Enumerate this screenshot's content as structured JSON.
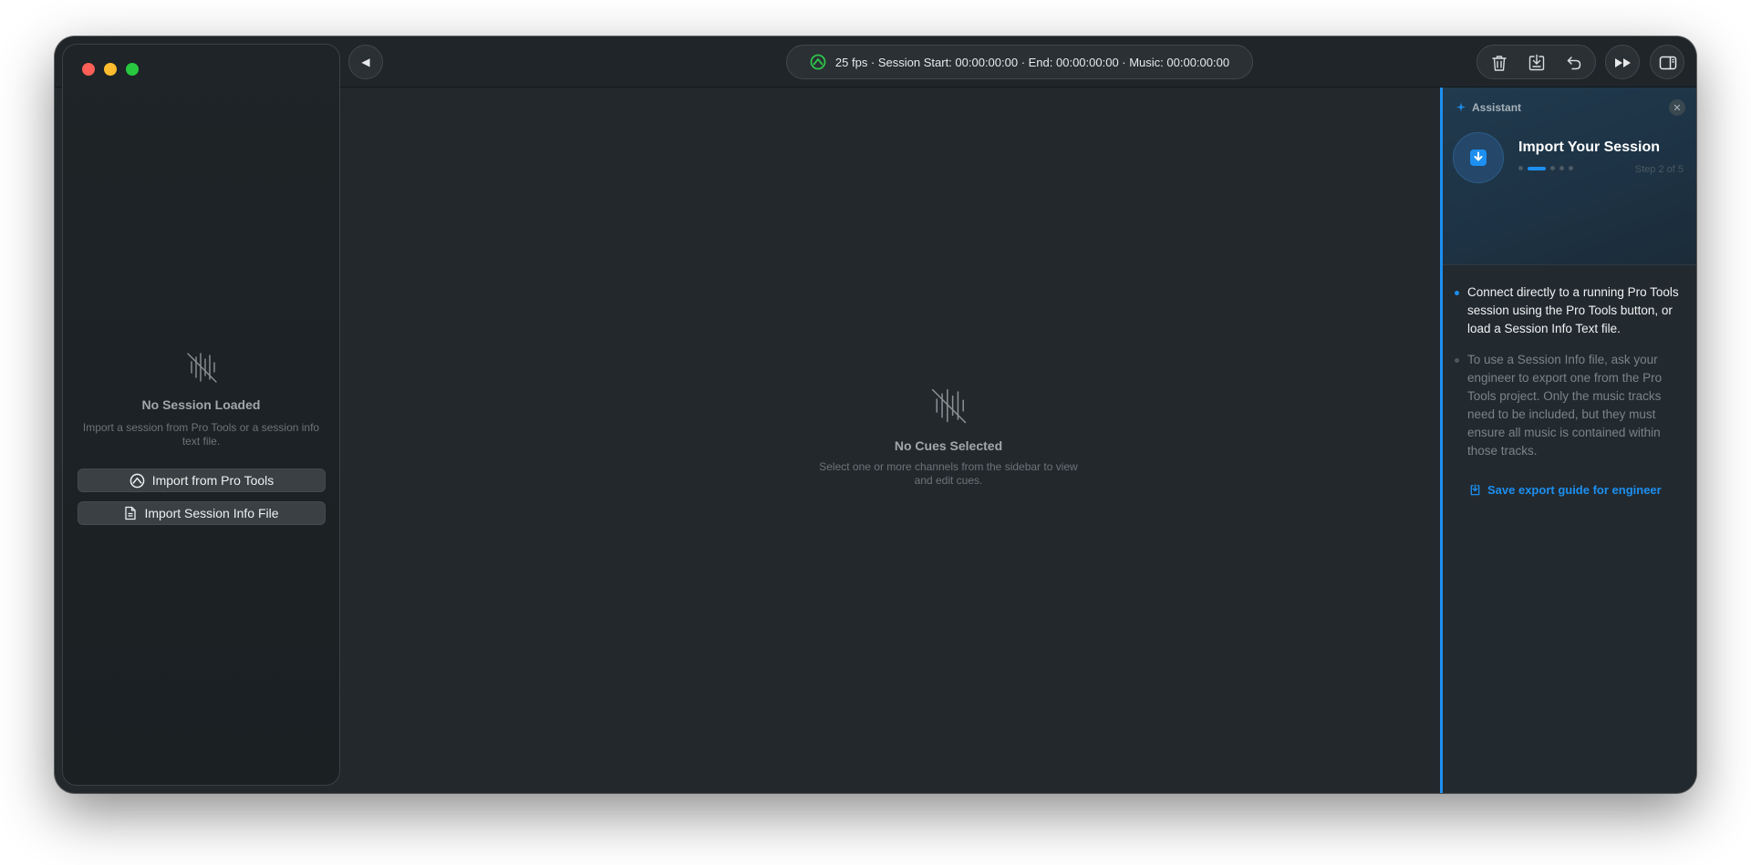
{
  "window": {
    "traffic_lights": [
      "close",
      "minimize",
      "zoom"
    ]
  },
  "sidebar": {
    "empty_title": "No Session Loaded",
    "empty_subtitle": "Import a session from Pro Tools or a session info text file.",
    "import_pro_tools_label": "Import from Pro Tools",
    "import_file_label": "Import Session Info File"
  },
  "toolbar": {
    "back_glyph": "◀",
    "status_text": "25 fps · Session Start: 00:00:00:00 · End: 00:00:00:00 · Music: 00:00:00:00",
    "icons": [
      "trash-icon",
      "import-icon",
      "undo-icon",
      "fast-forward-icon",
      "sidebar-toggle-icon"
    ]
  },
  "main": {
    "empty_title": "No Cues Selected",
    "empty_subtitle": "Select one or more channels from the sidebar to view and edit cues."
  },
  "assistant": {
    "label": "Assistant",
    "close_glyph": "✕",
    "title": "Import Your Session",
    "step_label": "Step 2 of 5",
    "current_step": 2,
    "total_steps": 5,
    "bullets": [
      "Connect directly to a running Pro Tools session using the Pro Tools button, or load a Session Info Text file.",
      "To use a Session Info file, ask your engineer to export one from the Pro Tools project. Only the music tracks need to be included, but they must ensure all music is contained within those tracks."
    ],
    "link_label": "Save export guide for engineer"
  },
  "colors": {
    "accent": "#1d8ff0",
    "status_green": "#2ec24a",
    "window_bg": "#22282c"
  }
}
